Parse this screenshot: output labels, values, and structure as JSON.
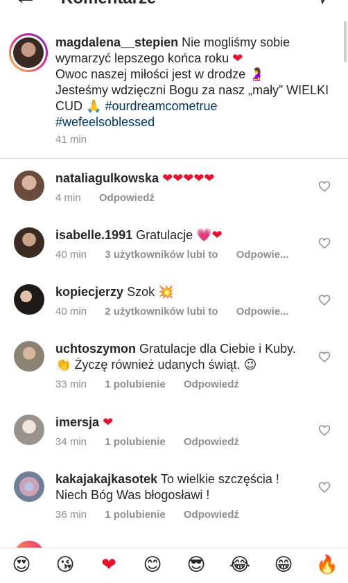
{
  "header": {
    "title": "Komentarze",
    "back_icon": "arrow-left-icon",
    "send_icon": "paper-plane-icon"
  },
  "caption": {
    "username": "magdalena__stepien",
    "line1": "Nie mogliśmy sobie wymarzyć lepszego końca roku",
    "line2": "Owoc naszej miłości jest w drodze",
    "line3": "Jesteśmy wdzięczni Bogu za nasz „mały” WIELKI CUD",
    "hashtag1": "#ourdreamcometrue",
    "hashtag2": "#wefeelsoblessed",
    "time": "41 min"
  },
  "comments": [
    {
      "username": "nataliagulkowska",
      "text": "",
      "emoji": "❤❤❤❤❤",
      "time": "4 min",
      "likes": "",
      "reply": "Odpowiedź"
    },
    {
      "username": "isabelle.1991",
      "text": "Gratulacje",
      "emoji": "💗❤",
      "time": "40 min",
      "likes": "3 użytkowników lubi to",
      "reply": "Odpowie..."
    },
    {
      "username": "kopiecjerzy",
      "text": "Szok",
      "emoji": "💥",
      "time": "40 min",
      "likes": "2 użytkowników lubi to",
      "reply": "Odpowie..."
    },
    {
      "username": "uchtoszymon",
      "text": "Gratulacje dla Ciebie i Kuby.",
      "text2": "Życzę również udanych świąt.",
      "emoji": "👏",
      "emoji2": "😉",
      "time": "33 min",
      "likes": "1 polubienie",
      "reply": "Odpowiedź"
    },
    {
      "username": "imersja",
      "text": "",
      "emoji": "❤",
      "time": "34 min",
      "likes": "1 polubienie",
      "reply": "Odpowiedź"
    },
    {
      "username": "kakajakajkasotek",
      "text": "To wielkie szczęścia !",
      "text2": "Niech Bóg Was błogosławi !",
      "time": "36 min",
      "likes": "1 polubienie",
      "reply": "Odpowiedź"
    }
  ],
  "emoji_bar": [
    "😍",
    "😘",
    "❤",
    "😊",
    "😎",
    "😂",
    "😁",
    "🔥"
  ],
  "colors": {
    "link": "#003569",
    "meta": "#8e8e8e",
    "heart": "#e8112d",
    "divider": "#dbdbdb"
  }
}
